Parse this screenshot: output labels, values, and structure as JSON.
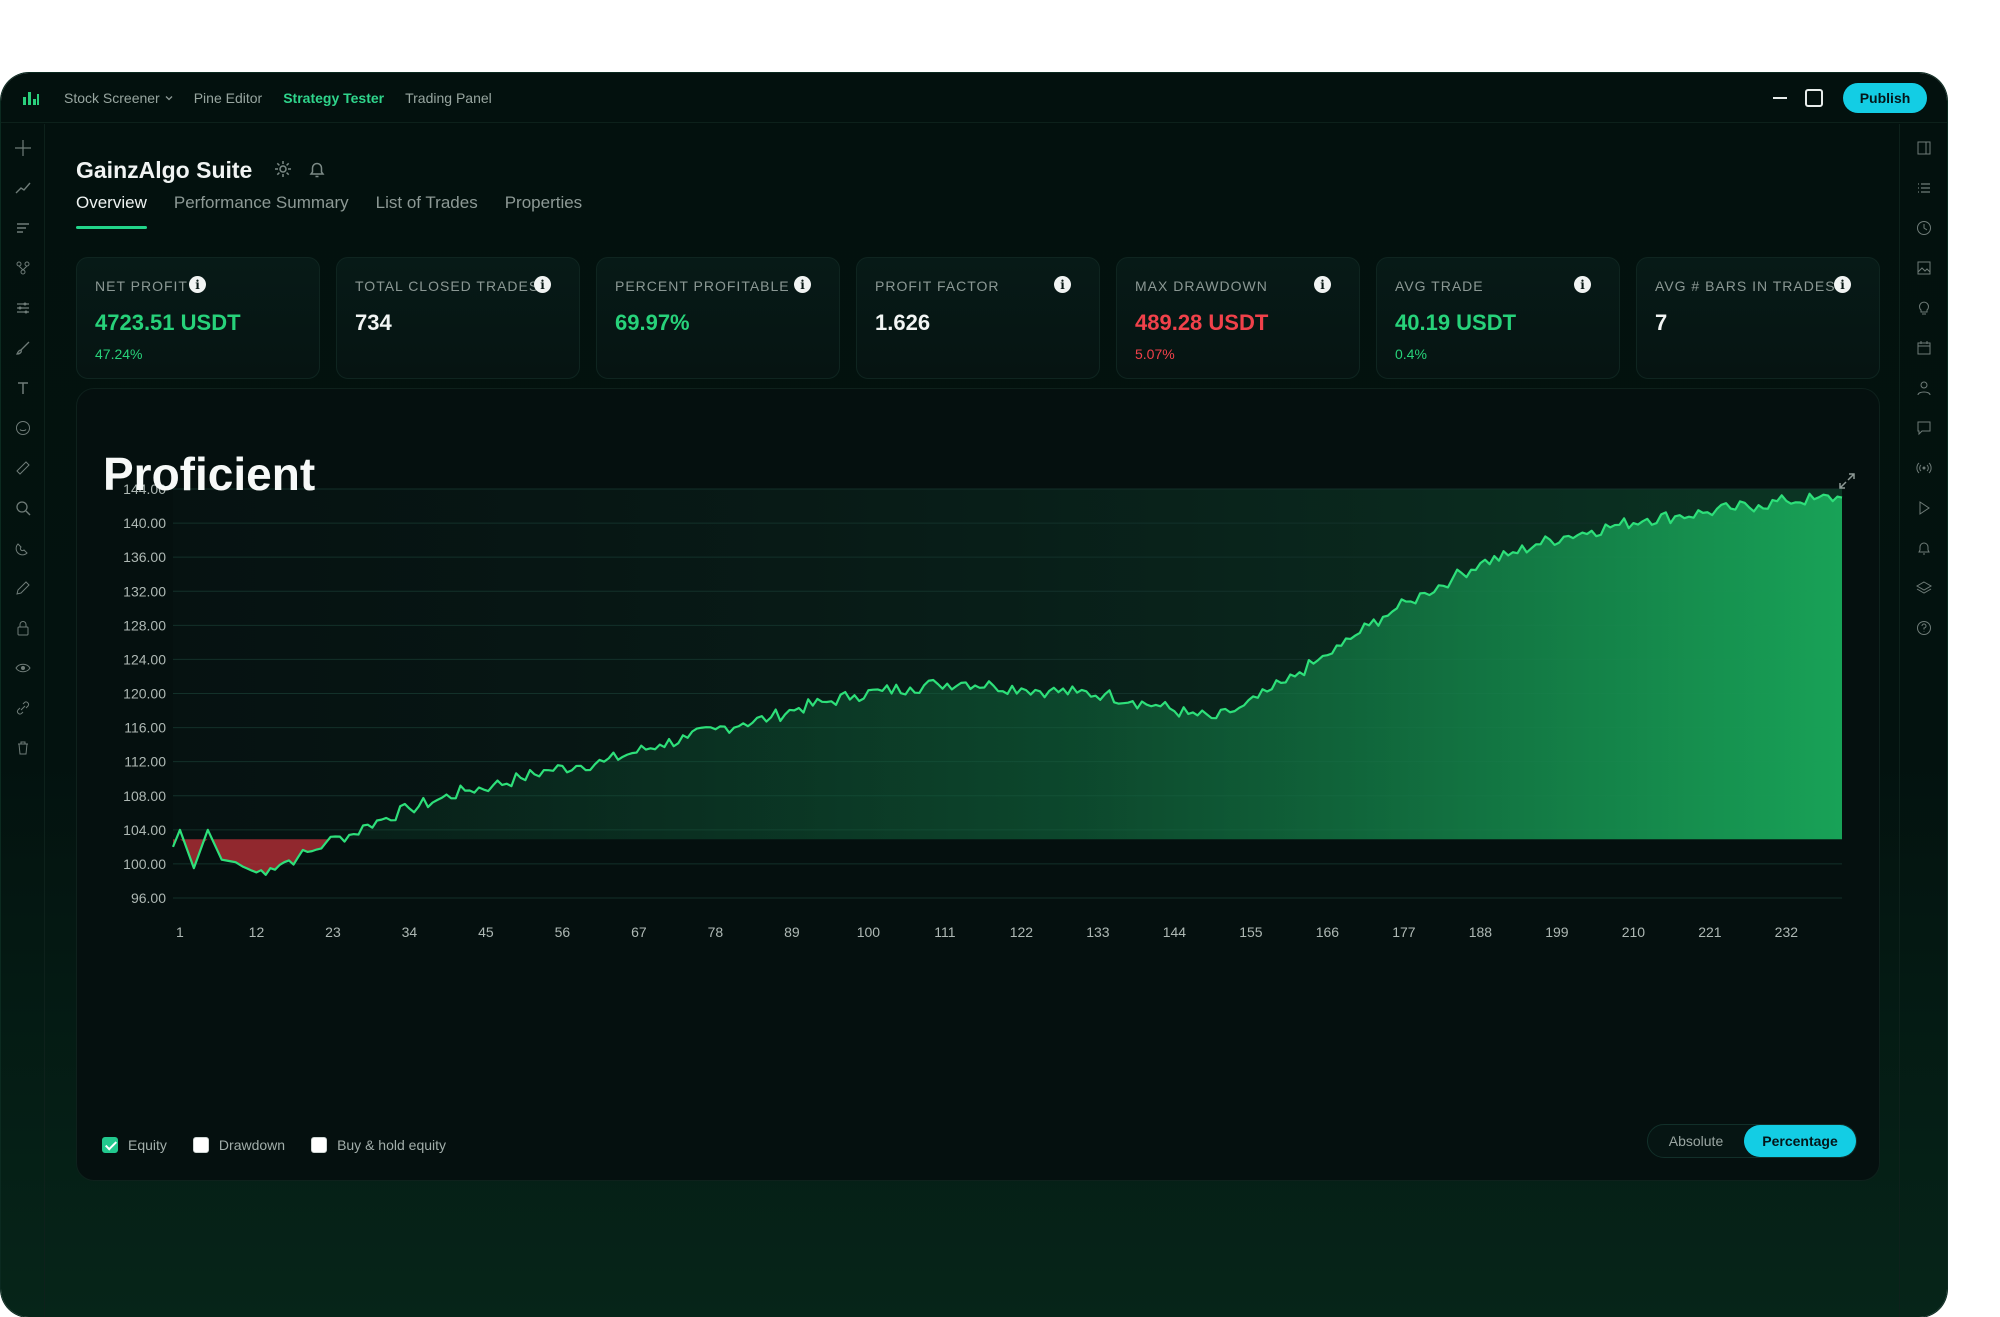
{
  "nav": {
    "items": [
      {
        "label": "Stock Screener",
        "dropdown": true
      },
      {
        "label": "Pine Editor"
      },
      {
        "label": "Strategy Tester",
        "active": true
      },
      {
        "label": "Trading Panel"
      }
    ],
    "publish_label": "Publish"
  },
  "left_tools": [
    "crosshair-icon",
    "trend-line-icon",
    "text-lines-icon",
    "fork-icon",
    "sliders-icon",
    "brush-icon",
    "text-tool-icon",
    "emoji-icon",
    "ruler-icon",
    "zoom-icon",
    "magnet-icon",
    "pencil-icon",
    "lock-icon",
    "eye-icon",
    "link-icon",
    "trash-icon"
  ],
  "right_tools": [
    "panel-icon",
    "list-icon",
    "clock-icon",
    "image-icon",
    "lightbulb-icon",
    "calendar-icon",
    "user-icon",
    "chat-icon",
    "broadcast-icon",
    "play-icon",
    "bell-icon",
    "layers-icon",
    "help-icon"
  ],
  "header": {
    "title": "GainzAlgo Suite",
    "tabs": [
      "Overview",
      "Performance Summary",
      "List of Trades",
      "Properties"
    ],
    "active_tab": 0
  },
  "metrics": [
    {
      "label": "Net Profit",
      "value": "4723.51 USDT",
      "sub": "47.24%",
      "tone": "green"
    },
    {
      "label": "Total Closed Trades",
      "value": "734",
      "sub": "",
      "tone": "neutral"
    },
    {
      "label": "Percent Profitable",
      "value": "69.97%",
      "sub": "",
      "tone": "green"
    },
    {
      "label": "Profit Factor",
      "value": "1.626",
      "sub": "",
      "tone": "neutral"
    },
    {
      "label": "Max Drawdown",
      "value": "489.28 USDT",
      "sub": "5.07%",
      "tone": "red"
    },
    {
      "label": "Avg Trade",
      "value": "40.19 USDT",
      "sub": "0.4%",
      "tone": "green"
    },
    {
      "label": "Avg # Bars in Trades",
      "value": "7",
      "sub": "",
      "tone": "neutral"
    }
  ],
  "info_glyph": "i",
  "panel": {
    "title": "Proficient",
    "legend": [
      {
        "label": "Equity",
        "checked": true
      },
      {
        "label": "Drawdown",
        "checked": false
      },
      {
        "label": "Buy & hold equity",
        "checked": false
      }
    ],
    "toggle": {
      "options": [
        "Absolute",
        "Percentage"
      ],
      "selected": "Percentage"
    }
  },
  "colors": {
    "accent": "#22d58a",
    "publish": "#13cde4",
    "loss": "#f0414a",
    "equity_line": "#2ee07a"
  },
  "chart_data": {
    "type": "area",
    "baseline": 102.9,
    "ylim": [
      96,
      144
    ],
    "yticks": [
      96,
      100,
      104,
      108,
      112,
      116,
      120,
      124,
      128,
      132,
      136,
      140,
      144
    ],
    "ytick_labels": [
      "96.00",
      "100.00",
      "104.00",
      "108.00",
      "112.00",
      "116.00",
      "120.00",
      "124.00",
      "128.00",
      "132.00",
      "136.00",
      "140.00",
      "144.00"
    ],
    "xlim": [
      0,
      240
    ],
    "xticks": [
      1,
      12,
      23,
      34,
      45,
      56,
      67,
      78,
      89,
      100,
      111,
      122,
      133,
      144,
      155,
      166,
      177,
      188,
      199,
      210,
      221,
      232
    ],
    "series": [
      {
        "x": [
          0,
          1,
          3,
          5,
          7,
          9,
          10,
          12,
          14,
          16,
          18,
          20,
          22,
          24,
          26,
          28,
          30,
          34,
          38,
          42,
          46,
          50,
          54,
          58,
          62,
          66,
          70,
          74,
          78,
          82,
          86,
          90,
          94,
          98,
          102,
          106,
          110,
          114,
          118,
          122,
          126,
          130,
          134,
          138,
          142,
          146,
          150,
          152,
          154,
          156,
          158,
          160,
          162,
          164,
          166,
          168,
          170,
          172,
          174,
          176,
          178,
          180,
          184,
          188,
          192,
          196,
          200,
          204,
          208,
          212,
          216,
          220,
          224,
          228,
          232,
          236,
          240
        ],
        "y": [
          102,
          104,
          99.5,
          104,
          100.5,
          100.2,
          99.7,
          99,
          99.5,
          100.2,
          100.8,
          101.5,
          102.5,
          103.2,
          103.5,
          104.6,
          105.2,
          106.5,
          107.5,
          108.6,
          109.2,
          110.1,
          111,
          111.5,
          112,
          113,
          114,
          114.8,
          115.8,
          116.5,
          117.2,
          118.3,
          119,
          119.8,
          120.3,
          120.7,
          121.1,
          121.3,
          120.9,
          120.6,
          120.3,
          120.1,
          119.9,
          119.1,
          118.5,
          117.6,
          117.1,
          117.8,
          118.6,
          119.5,
          120.5,
          121.3,
          122.5,
          123.5,
          124.5,
          125.6,
          126.8,
          128,
          129,
          130,
          130.8,
          131.8,
          133.5,
          135.3,
          136.2,
          137.5,
          138.4,
          139.1,
          139.8,
          140.5,
          140.8,
          141.2,
          141.7,
          142.1,
          142.6,
          142.8,
          143
        ]
      }
    ]
  }
}
